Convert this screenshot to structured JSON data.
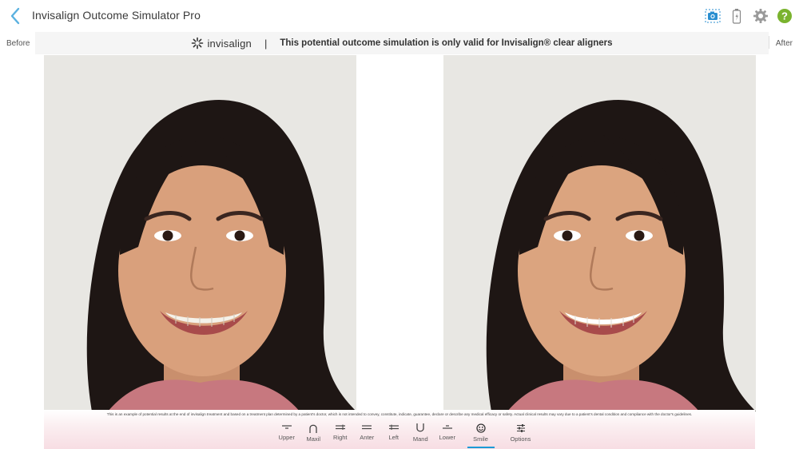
{
  "header": {
    "title": "Invisalign Outcome Simulator Pro",
    "icons": [
      "back-arrow-icon",
      "camera-icon",
      "battery-icon",
      "gear-icon",
      "help-icon"
    ],
    "accent_color": "#5ab1e0",
    "help_color": "#7ab32e"
  },
  "banner": {
    "brand": "invisalign",
    "brand_mark": "·",
    "separator": "|",
    "message": "This potential outcome simulation is only valid for Invisalign® clear aligners"
  },
  "labels": {
    "before": "Before",
    "after": "After"
  },
  "footer": {
    "fine_print": "This is an example of potential results at the end of invisalign treatment and based on a treatment plan determined by a patient's doctor, which is not intended to convey, constitute, indicate, guarantee, declare or describe any medical efficacy or safety. Actual clinical results may vary due to a patient's dental condition and compliance with the doctor's guidelines.",
    "tools": [
      {
        "label": "Upper",
        "icon": "upper-jaw-icon"
      },
      {
        "label": "Maxil",
        "icon": "maxillary-arch-icon"
      },
      {
        "label": "Right",
        "icon": "right-view-icon"
      },
      {
        "label": "Anter",
        "icon": "anterior-view-icon"
      },
      {
        "label": "Left",
        "icon": "left-view-icon"
      },
      {
        "label": "Mand",
        "icon": "mandibular-arch-icon"
      },
      {
        "label": "Lower",
        "icon": "lower-jaw-icon"
      },
      {
        "label": "Smile",
        "icon": "smile-face-icon",
        "active": true
      },
      {
        "label": "Options",
        "icon": "sliders-icon"
      }
    ]
  }
}
